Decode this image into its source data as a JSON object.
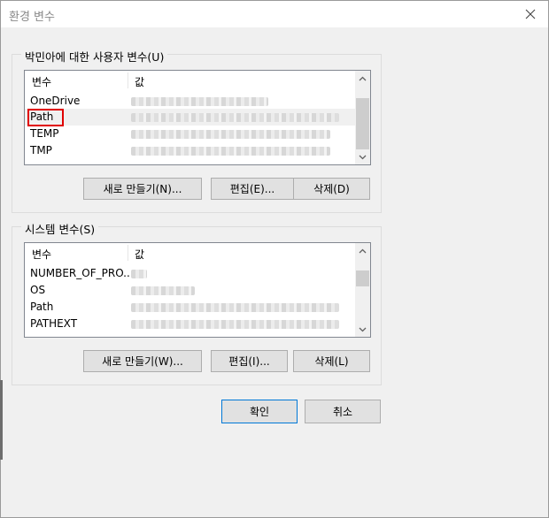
{
  "window": {
    "title": "환경 변수"
  },
  "user_vars": {
    "group_label": "박민아에 대한 사용자 변수(U)",
    "header": {
      "name": "변수",
      "value": "값"
    },
    "rows": [
      {
        "name": "OneDrive"
      },
      {
        "name": "Path"
      },
      {
        "name": "TEMP"
      },
      {
        "name": "TMP"
      }
    ],
    "new_label": "새로 만들기(N)...",
    "edit_label": "편집(E)...",
    "delete_label": "삭제(D)"
  },
  "system_vars": {
    "group_label": "시스템 변수(S)",
    "header": {
      "name": "변수",
      "value": "값"
    },
    "rows": [
      {
        "name": "NUMBER_OF_PRO..."
      },
      {
        "name": "OS"
      },
      {
        "name": "Path"
      },
      {
        "name": "PATHEXT"
      }
    ],
    "new_label": "새로 만들기(W)...",
    "edit_label": "편집(I)...",
    "delete_label": "삭제(L)"
  },
  "footer": {
    "ok_label": "확인",
    "cancel_label": "취소"
  },
  "colors": {
    "highlight": "#e00000",
    "selected_row": "#f0f0f0"
  },
  "icons": {
    "close": "close-icon",
    "scroll_up": "chevron-up-icon",
    "scroll_down": "chevron-down-icon"
  }
}
